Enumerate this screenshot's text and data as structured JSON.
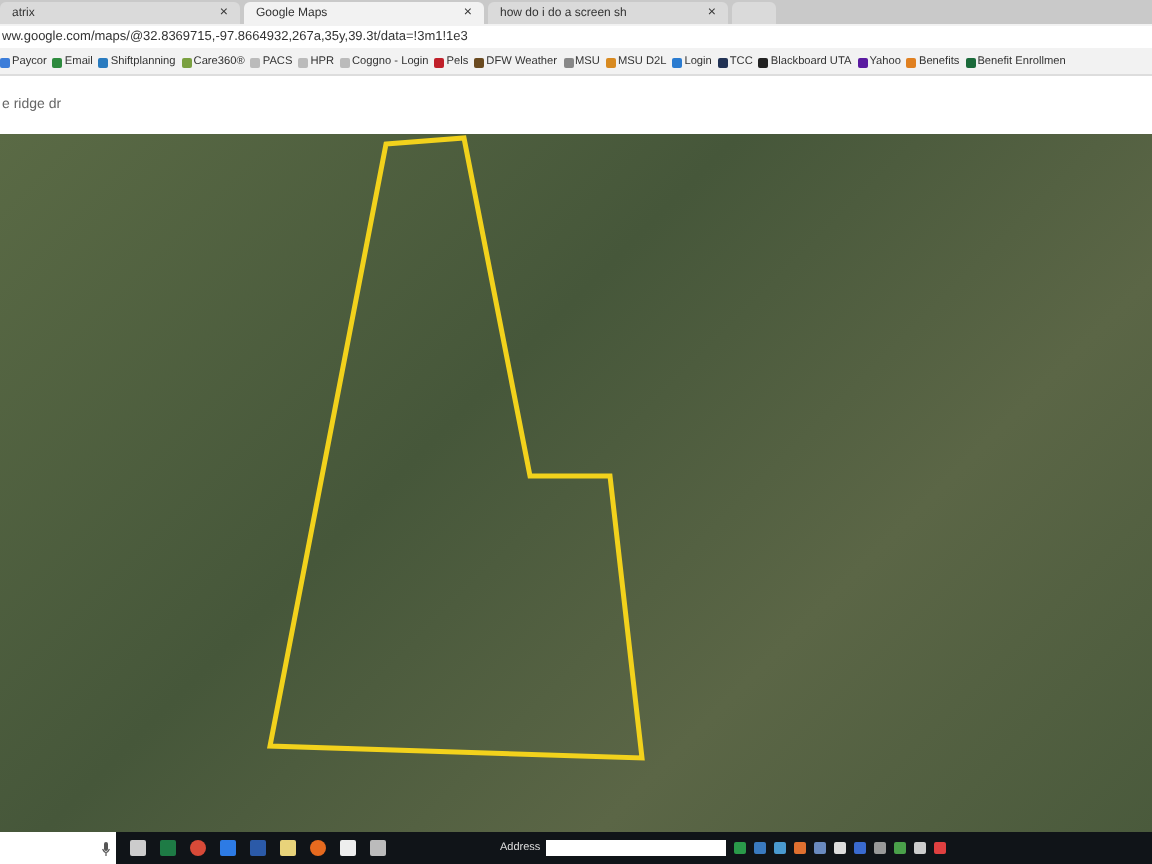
{
  "tabs": [
    {
      "title": "atrix",
      "close": "×",
      "selected": false
    },
    {
      "title": "Google Maps",
      "close": "×",
      "selected": true
    },
    {
      "title": "how do i do a screen sh",
      "close": "×",
      "selected": false
    }
  ],
  "address_bar": {
    "url": "ww.google.com/maps/@32.8369715,-97.8664932,267a,35y,39.3t/data=!3m1!1e3"
  },
  "bookmarks": [
    {
      "label": "Paycor",
      "color": "#3c7dd9"
    },
    {
      "label": "Email",
      "color": "#2e8b3e"
    },
    {
      "label": "Shiftplanning",
      "color": "#2a7bbf"
    },
    {
      "label": "Care360®",
      "color": "#7aa040"
    },
    {
      "label": "PACS",
      "color": "#bbbbbb"
    },
    {
      "label": "HPR",
      "color": "#bbbbbb"
    },
    {
      "label": "Coggno - Login",
      "color": "#bbbbbb"
    },
    {
      "label": "Pels",
      "color": "#c0202a"
    },
    {
      "label": "DFW Weather",
      "color": "#6a4a20"
    },
    {
      "label": "MSU",
      "color": "#888888"
    },
    {
      "label": "MSU D2L",
      "color": "#d88a20"
    },
    {
      "label": "Login",
      "color": "#2a7bd0"
    },
    {
      "label": "TCC",
      "color": "#223355"
    },
    {
      "label": "Blackboard UTA",
      "color": "#222222"
    },
    {
      "label": "Yahoo",
      "color": "#5a1aa0"
    },
    {
      "label": "Benefits",
      "color": "#e08020"
    },
    {
      "label": "Benefit Enrollmen",
      "color": "#1a6a3a"
    }
  ],
  "search": {
    "value": "e ridge dr"
  },
  "taskbar": {
    "address_label": "Address"
  }
}
